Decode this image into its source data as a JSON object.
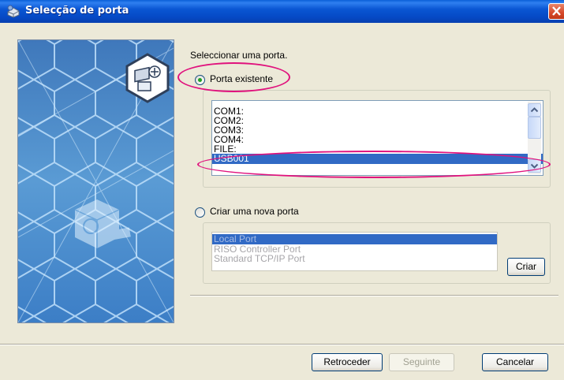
{
  "window": {
    "title": "Selecção de porta"
  },
  "instruction": "Seleccionar uma porta.",
  "existing_port": {
    "label": "Porta existente",
    "checked": true,
    "ports": [
      "COM1:",
      "COM2:",
      "COM3:",
      "COM4:",
      "FILE:",
      "USB001"
    ],
    "selected_index": 5
  },
  "new_port": {
    "label": "Criar uma nova porta",
    "checked": false,
    "types": [
      "Local Port",
      "RISO Controller Port",
      "Standard TCP/IP Port"
    ],
    "selected_index": 0,
    "create_button": "Criar"
  },
  "buttons": {
    "back": "Retroceder",
    "next": "Seguinte",
    "cancel": "Cancelar"
  },
  "colors": {
    "title_bar": "#0a56d3",
    "selection": "#316ac5",
    "highlight_annotation": "#e0127d"
  },
  "icons": [
    "printer-port-icon",
    "close-icon",
    "scroll-up-icon",
    "scroll-down-icon",
    "computer-port-icon"
  ]
}
